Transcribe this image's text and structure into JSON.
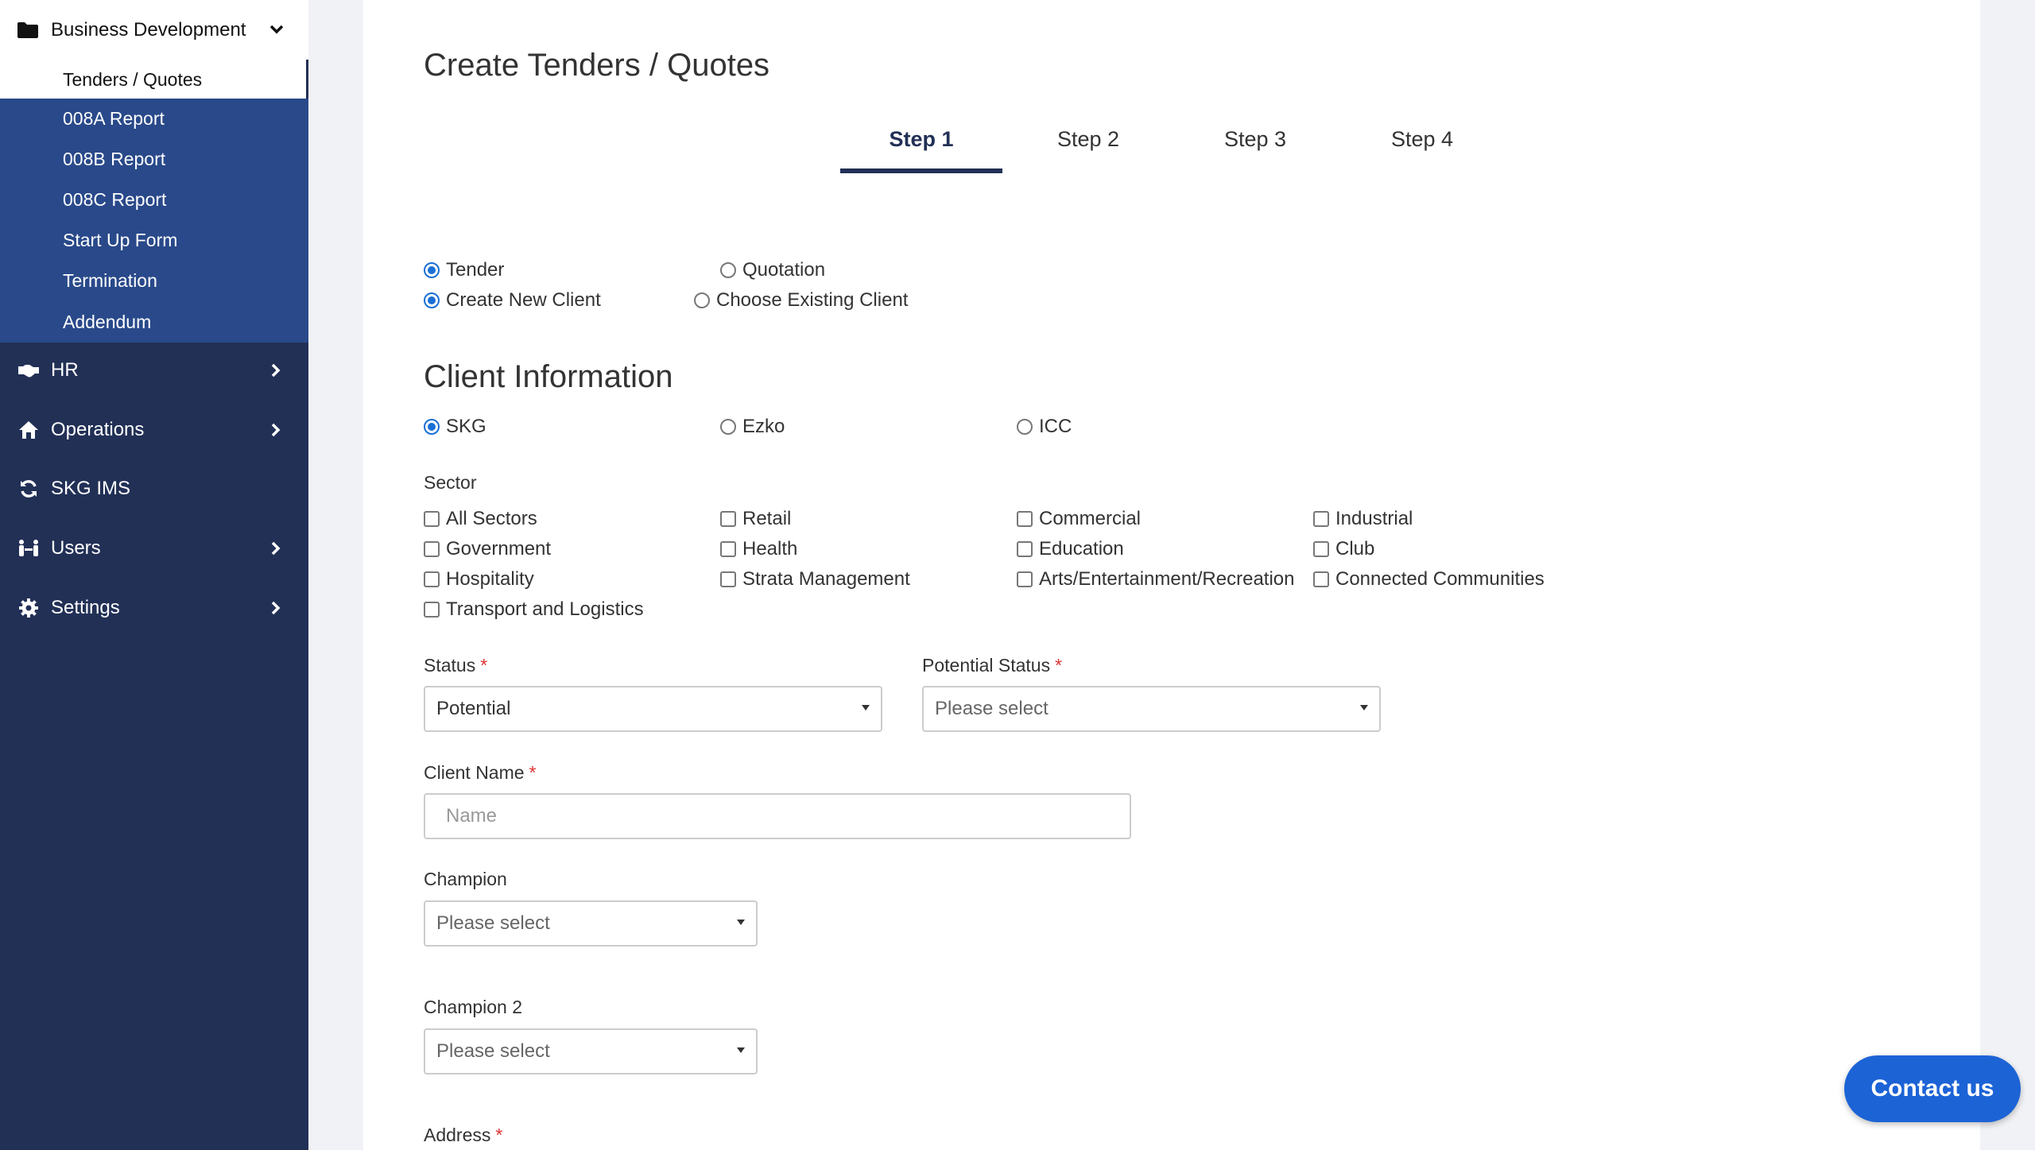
{
  "sidebar": {
    "group_title": "Business Development",
    "sub_items": [
      {
        "label": "Tenders / Quotes",
        "active": true
      },
      {
        "label": "008A Report"
      },
      {
        "label": "008B Report"
      },
      {
        "label": "008C Report"
      },
      {
        "label": "Start Up Form"
      },
      {
        "label": "Termination"
      },
      {
        "label": "Addendum"
      }
    ],
    "items": [
      {
        "label": "HR",
        "icon": "handshake-icon",
        "has_chevron": true
      },
      {
        "label": "Operations",
        "icon": "home-icon",
        "has_chevron": true
      },
      {
        "label": "SKG IMS",
        "icon": "sync-icon",
        "has_chevron": false
      },
      {
        "label": "Users",
        "icon": "users-icon",
        "has_chevron": true
      },
      {
        "label": "Settings",
        "icon": "gear-icon",
        "has_chevron": true
      }
    ]
  },
  "main": {
    "title": "Create Tenders / Quotes",
    "steps": [
      "Step 1",
      "Step 2",
      "Step 3",
      "Step 4"
    ],
    "active_step": "Step 1",
    "type_options": {
      "tender": "Tender",
      "quotation": "Quotation"
    },
    "client_options": {
      "new": "Create New Client",
      "existing": "Choose Existing Client"
    },
    "client_info_title": "Client Information",
    "companies": [
      "SKG",
      "Ezko",
      "ICC"
    ],
    "sector_label": "Sector",
    "sectors": [
      "All Sectors",
      "Retail",
      "Commercial",
      "Industrial",
      "Government",
      "Health",
      "Education",
      "Club",
      "Hospitality",
      "Strata Management",
      "Arts/Entertainment/Recreation",
      "Connected Communities",
      "Transport and Logistics"
    ],
    "status_label": "Status",
    "status_value": "Potential",
    "potential_status_label": "Potential Status",
    "potential_status_placeholder": "Please select",
    "client_name_label": "Client Name",
    "client_name_placeholder": "Name",
    "champion_label": "Champion",
    "champion_placeholder": "Please select",
    "champion2_label": "Champion 2",
    "champion2_placeholder": "Please select",
    "address_label": "Address",
    "required_mark": "*"
  },
  "contact_button": "Contact us",
  "colors": {
    "sidebar_bg": "#223056",
    "sidebar_sub_bg": "#29498a",
    "accent": "#1c63d6",
    "step_active": "#223056",
    "required": "#dd3333"
  }
}
